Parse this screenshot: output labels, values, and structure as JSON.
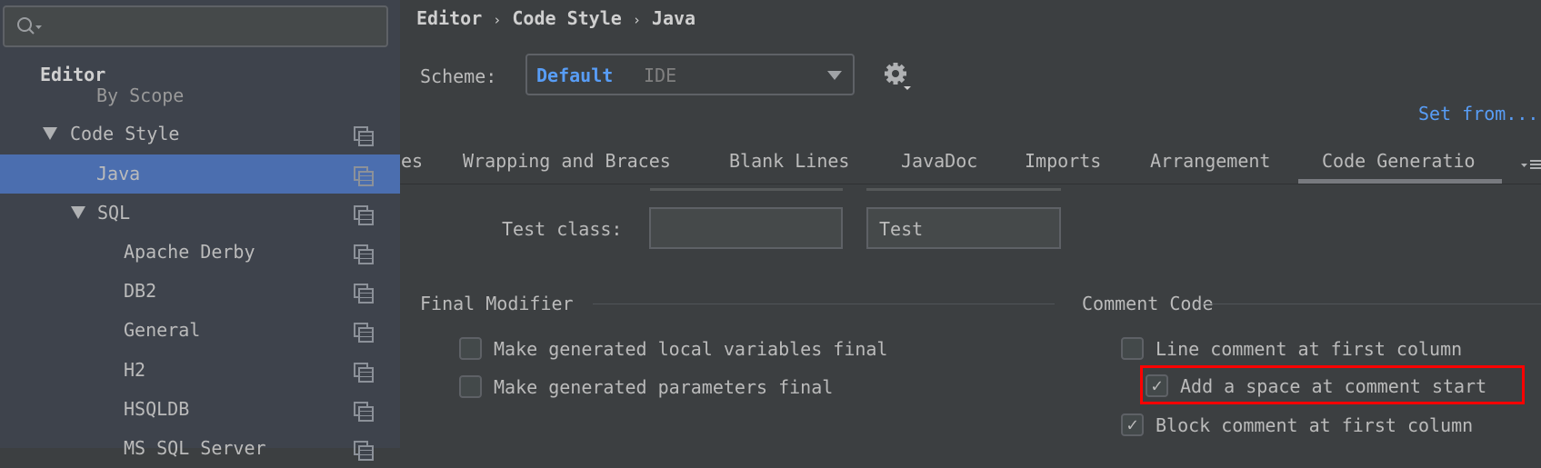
{
  "sidebar": {
    "search": {
      "value": "",
      "icon": "search-icon"
    },
    "header": "Editor",
    "items": [
      {
        "label": "By Scope"
      },
      {
        "label": "Code Style",
        "expanded": true
      },
      {
        "label": "Java",
        "selected": true
      },
      {
        "label": "SQL",
        "expanded": true
      },
      {
        "label": "Apache Derby"
      },
      {
        "label": "DB2"
      },
      {
        "label": "General"
      },
      {
        "label": "H2"
      },
      {
        "label": "HSQLDB"
      },
      {
        "label": "MS SQL Server"
      }
    ]
  },
  "breadcrumb": {
    "items": [
      "Editor",
      "Code Style",
      "Java"
    ],
    "separator": "›"
  },
  "scheme": {
    "label": "Scheme:",
    "value": "Default",
    "sub": "IDE"
  },
  "set_from": "Set from...",
  "tabs": [
    "es",
    "Wrapping and Braces",
    "Blank Lines",
    "JavaDoc",
    "Imports",
    "Arrangement",
    "Code Generatio"
  ],
  "active_tab": "Code Generation",
  "test_class": {
    "label": "Test class:",
    "prefix": "",
    "suffix": "Test"
  },
  "final_modifier": {
    "title": "Final Modifier",
    "options": [
      {
        "label": "Make generated local variables final",
        "checked": false
      },
      {
        "label": "Make generated parameters final",
        "checked": false
      }
    ]
  },
  "comment_code": {
    "title": "Comment Code",
    "options": [
      {
        "label": "Line comment at first column",
        "checked": false
      },
      {
        "label": "Add a space at comment start",
        "checked": true,
        "highlighted": true
      },
      {
        "label": "Block comment at first column",
        "checked": true
      }
    ]
  },
  "colors": {
    "accent": "#589df6",
    "selection": "#4b6eaf",
    "highlight": "#ff0000"
  }
}
